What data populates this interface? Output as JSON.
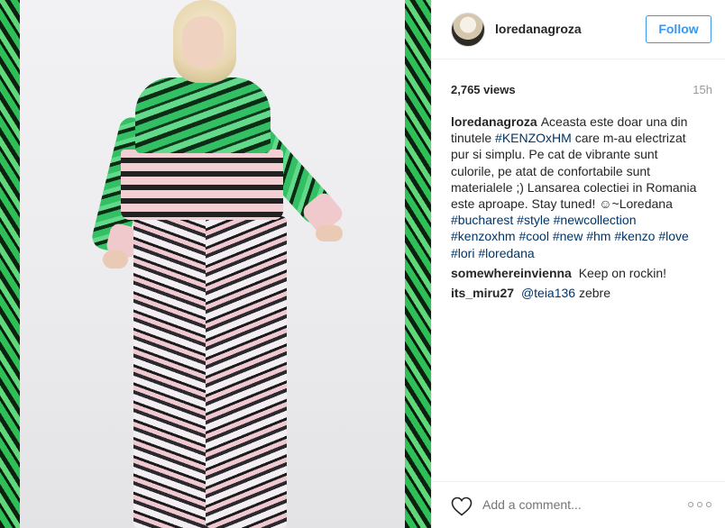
{
  "post": {
    "username": "loredanagroza",
    "follow_label": "Follow",
    "views": "2,765 views",
    "time_ago": "15h"
  },
  "caption": {
    "user": "loredanagroza",
    "lines": [
      "Aceasta este doar una din",
      "tinutele",
      "#KENZOxHM",
      "care m-au electrizat",
      "pur si simplu. Pe cat de vibrante sunt",
      "culorile, pe atat de confortabile sunt",
      "materialele ;) Lansarea colectiei in Romania",
      "este aproape. Stay tuned! ☺~Loredana"
    ],
    "hashtags_line1": [
      "#bucharest",
      "#style",
      "#newcollection"
    ],
    "hashtags_line2": [
      "#kenzoxhm",
      "#cool",
      "#new",
      "#hm",
      "#kenzo",
      "#love"
    ],
    "hashtags_line3": [
      "#lori",
      "#loredana"
    ]
  },
  "comments": [
    {
      "user": "somewhereinvienna",
      "text": "Keep on rockin!"
    },
    {
      "user": "its_miru27",
      "mention": "@teia136",
      "text": "zebre"
    }
  ],
  "footer": {
    "add_comment_placeholder": "Add a comment..."
  },
  "icons": {
    "like": "heart-icon",
    "options": "more-options-icon"
  },
  "colors": {
    "accent": "#3897f0",
    "hashtag": "#003569",
    "muted": "#999999",
    "text": "#262626"
  }
}
